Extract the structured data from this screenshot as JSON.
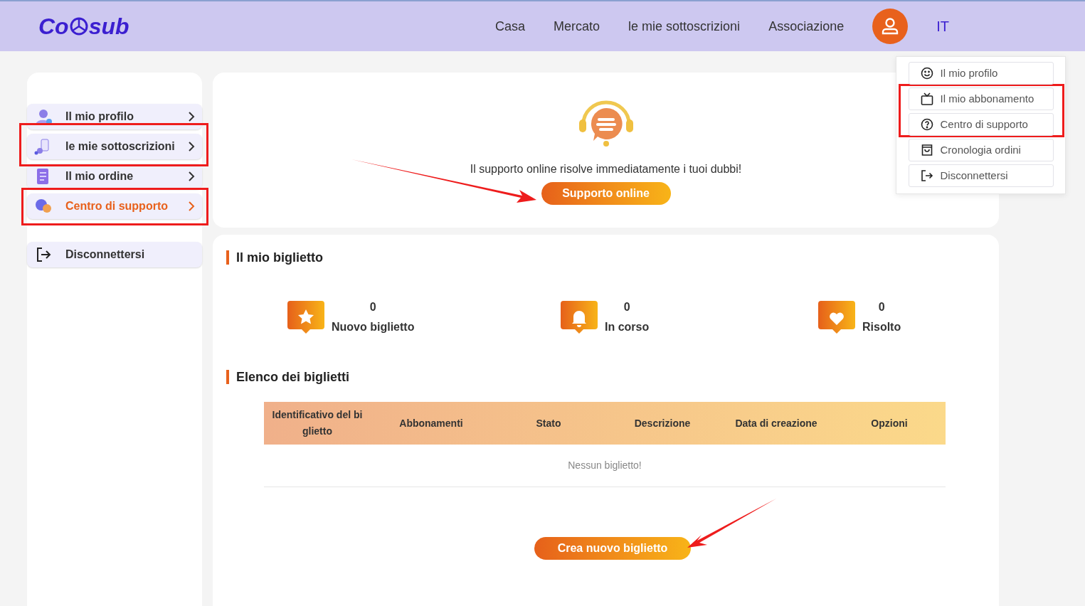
{
  "header": {
    "logo": [
      "Co",
      "sub"
    ],
    "nav": [
      {
        "label": "Casa"
      },
      {
        "label": "Mercato"
      },
      {
        "label": "le mie sottoscrizioni"
      },
      {
        "label": "Associazione"
      }
    ],
    "language": "IT"
  },
  "user_menu": {
    "items": [
      {
        "kind": "profile",
        "label": "Il mio profilo"
      },
      {
        "kind": "subscription",
        "label": "Il mio abbonamento"
      },
      {
        "kind": "support",
        "label": "Centro di supporto"
      },
      {
        "kind": "orders",
        "label": "Cronologia ordini"
      },
      {
        "kind": "logout",
        "label": "Disconnettersi"
      }
    ]
  },
  "sidebar": {
    "items": [
      {
        "kind": "profile",
        "label": "Il mio profilo",
        "selected": false
      },
      {
        "kind": "subscriptions",
        "label": "le mie sottoscrizioni",
        "selected": false
      },
      {
        "kind": "order",
        "label": "Il mio ordine",
        "selected": false
      },
      {
        "kind": "support",
        "label": "Centro di supporto",
        "selected": true
      }
    ],
    "logout": "Disconnettersi"
  },
  "support_card": {
    "message": "Il supporto online risolve immediatamente i tuoi dubbi!",
    "button": "Supporto online"
  },
  "tickets": {
    "title": "Il mio biglietto",
    "stats": [
      {
        "kind": "new",
        "count": "0",
        "label": "Nuovo biglietto"
      },
      {
        "kind": "progress",
        "count": "0",
        "label": "In corso"
      },
      {
        "kind": "resolved",
        "count": "0",
        "label": "Risolto"
      }
    ],
    "list_title": "Elenco dei biglietti",
    "columns": [
      "Identificativo del biglietto",
      "Abbonamenti",
      "Stato",
      "Descrizione",
      "Data di creazione",
      "Opzioni"
    ],
    "empty": "Nessun biglietto!",
    "button": "Crea nuovo biglietto"
  }
}
